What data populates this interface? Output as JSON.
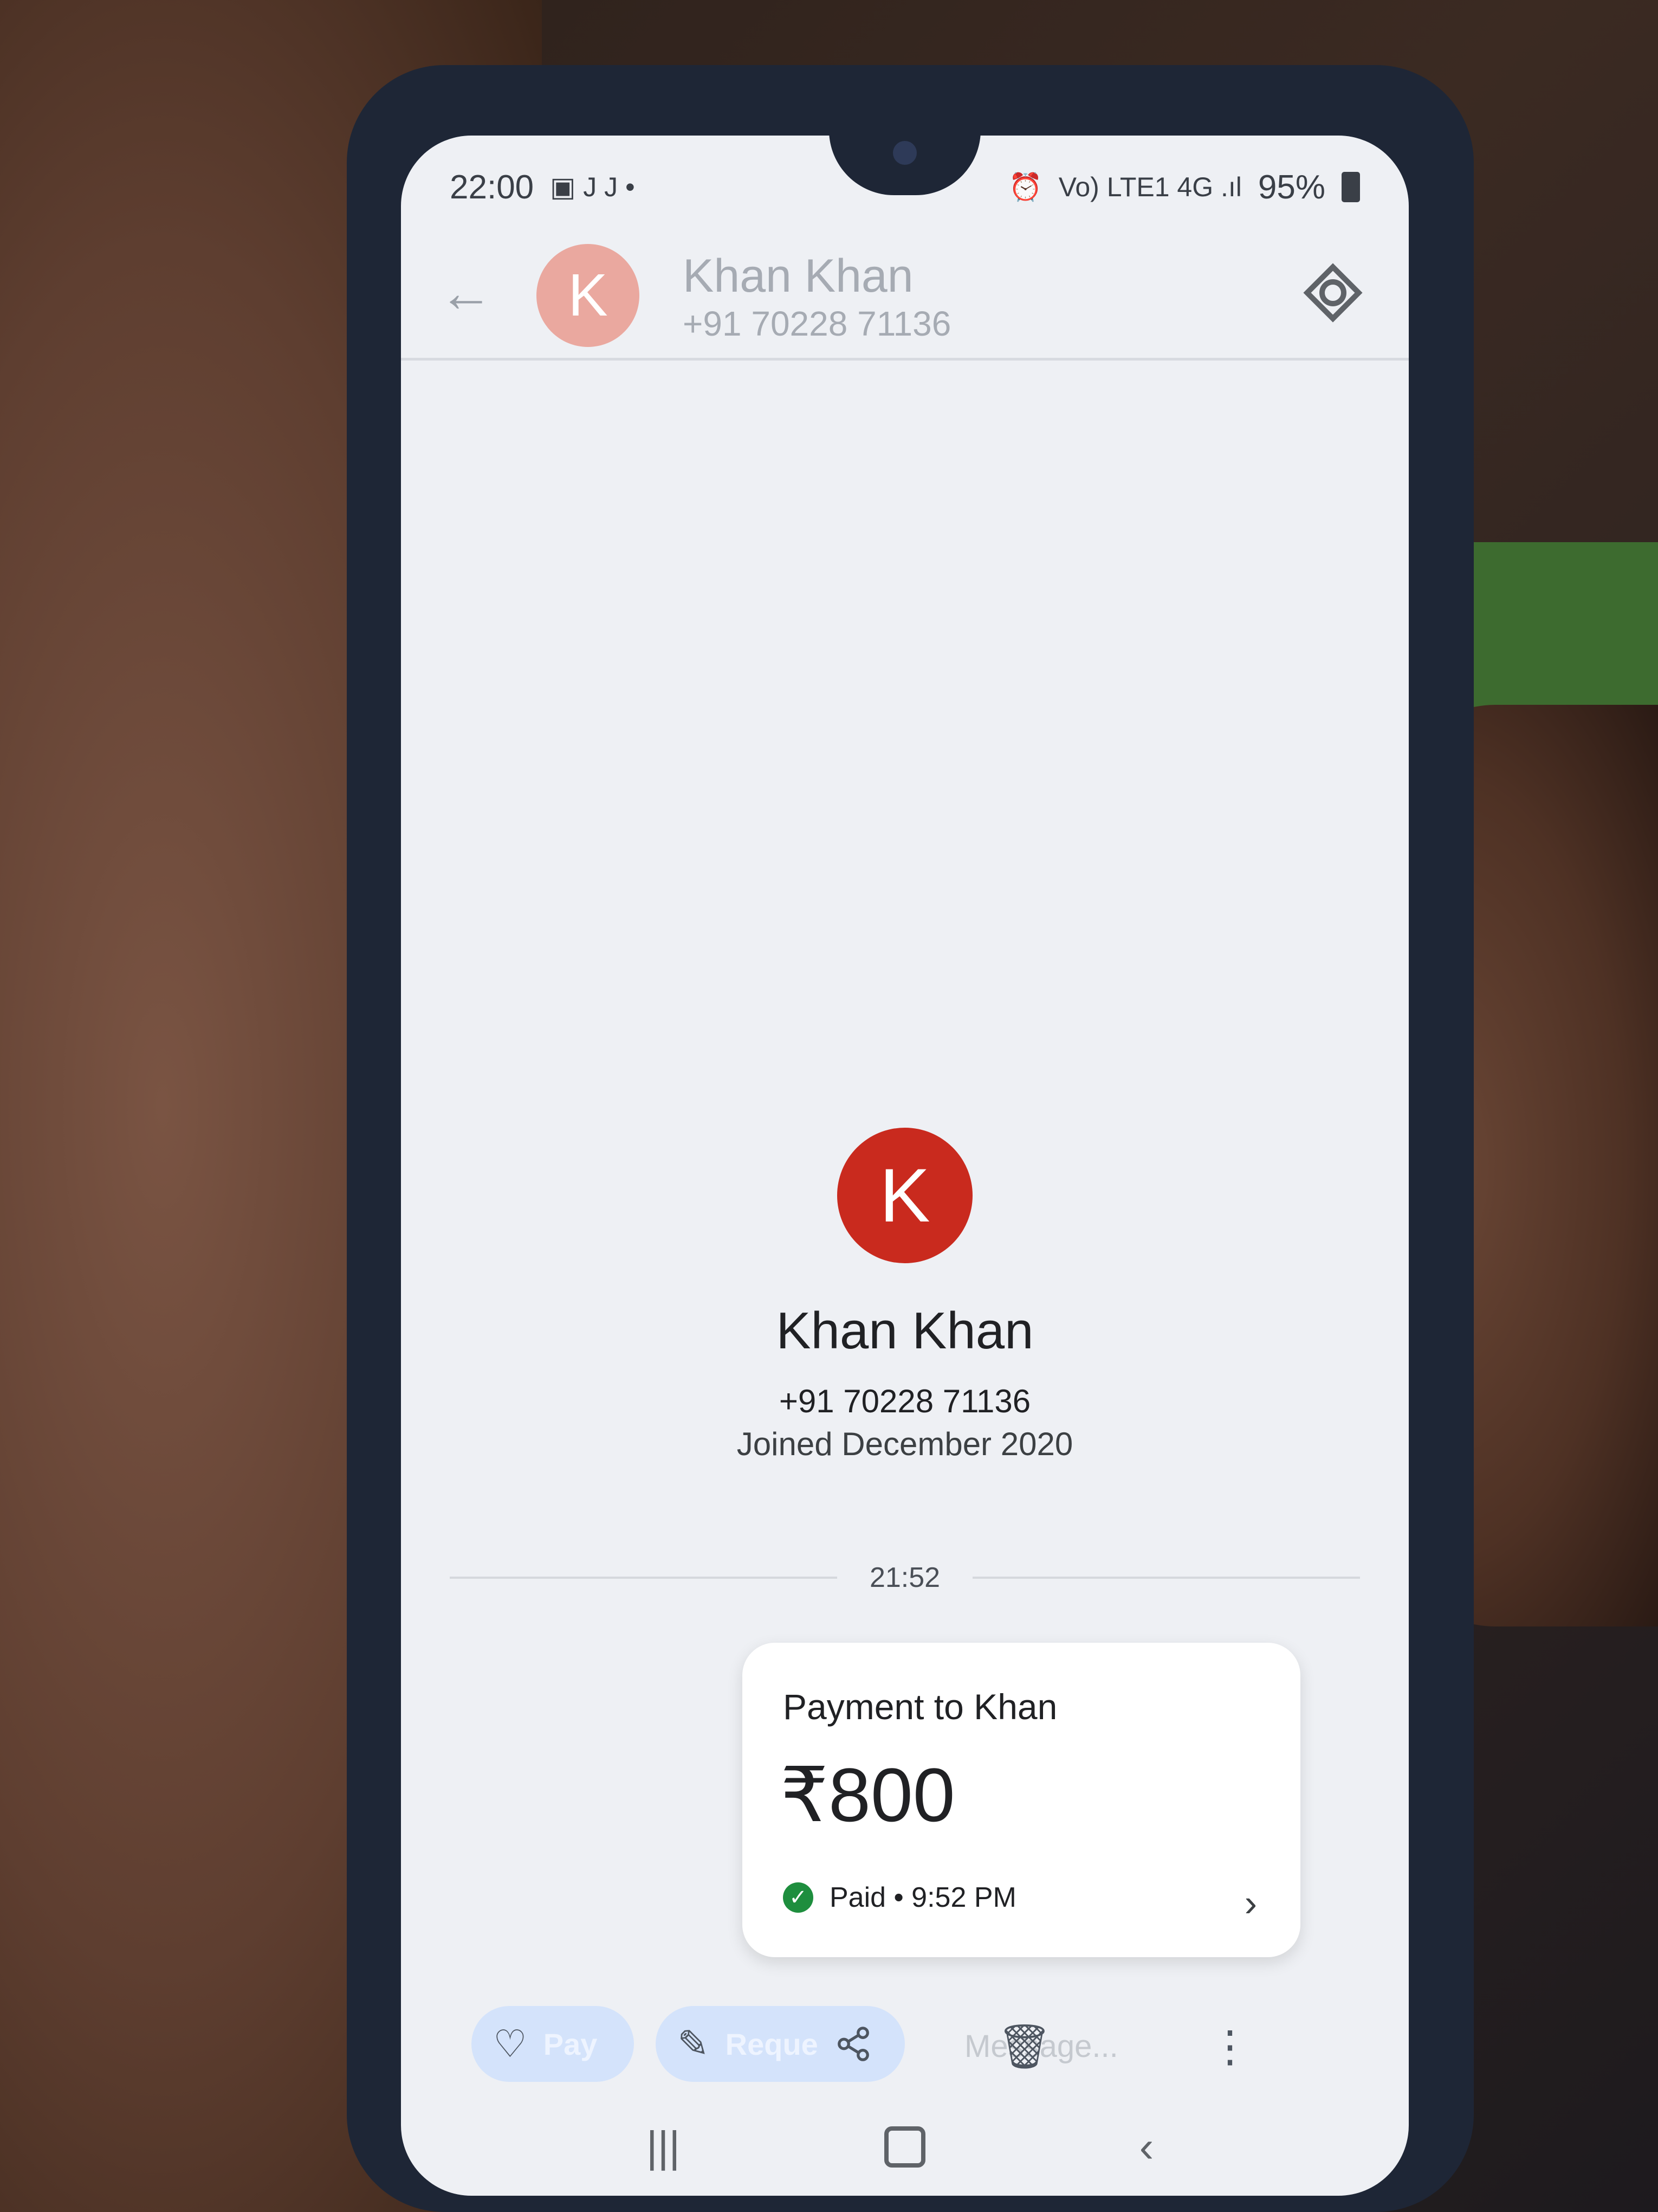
{
  "status_bar": {
    "time": "22:00",
    "notifications": "▣ J J •",
    "signal": "Vo) LTE1 4G .ıl",
    "battery": "95%"
  },
  "header": {
    "avatar_letter": "K",
    "contact_name": "Khan Khan",
    "contact_phone": "+91 70228 71136"
  },
  "profile": {
    "avatar_letter": "K",
    "name": "Khan Khan",
    "phone": "+91 70228 71136",
    "joined": "Joined December 2020"
  },
  "divider_time": "21:52",
  "payment": {
    "title": "Payment to Khan",
    "amount": "₹800",
    "status": "Paid • 9:52 PM"
  },
  "actions": {
    "pay_label": "Pay",
    "request_label": "Reque",
    "message_placeholder": "Message..."
  },
  "colors": {
    "avatar_red": "#c92a1e",
    "avatar_faded": "#eaa89f",
    "paid_green": "#1e8e3e",
    "pill_blue": "#d4e3fb"
  }
}
